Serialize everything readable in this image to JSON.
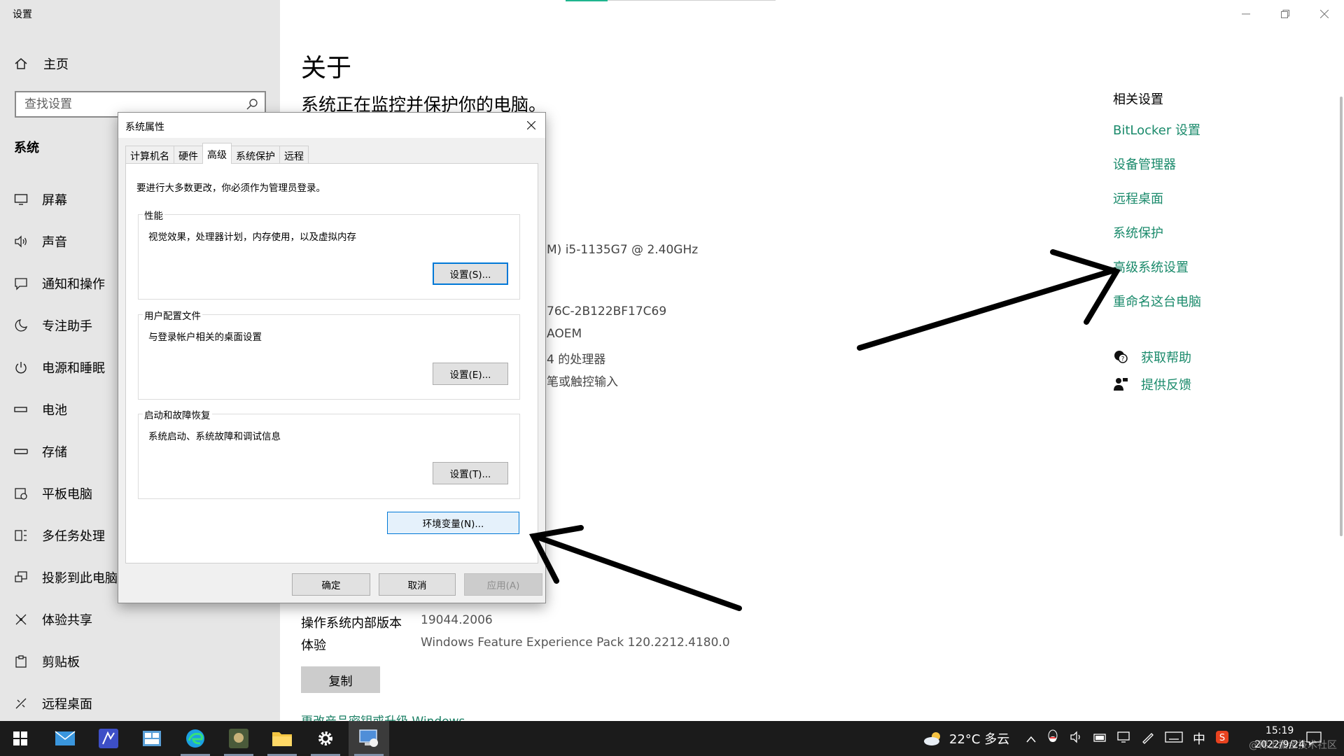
{
  "app": {
    "title": "设置",
    "home_label": "主页",
    "search_placeholder": "查找设置",
    "section_label": "系统"
  },
  "sidebar": {
    "items": [
      {
        "label": "屏幕",
        "icon": "monitor-icon"
      },
      {
        "label": "声音",
        "icon": "speaker-icon"
      },
      {
        "label": "通知和操作",
        "icon": "notification-icon"
      },
      {
        "label": "专注助手",
        "icon": "moon-icon"
      },
      {
        "label": "电源和睡眠",
        "icon": "power-icon"
      },
      {
        "label": "电池",
        "icon": "battery-icon"
      },
      {
        "label": "存储",
        "icon": "storage-icon"
      },
      {
        "label": "平板电脑",
        "icon": "tablet-icon"
      },
      {
        "label": "多任务处理",
        "icon": "multitask-icon"
      },
      {
        "label": "投影到此电脑",
        "icon": "project-icon"
      },
      {
        "label": "体验共享",
        "icon": "share-icon"
      },
      {
        "label": "剪贴板",
        "icon": "clipboard-icon"
      },
      {
        "label": "远程桌面",
        "icon": "remote-icon"
      }
    ]
  },
  "main": {
    "title": "关于",
    "subtitle": "系统正在监控并保护你的电脑。",
    "partial_specs": [
      "M) i5-1135G7 @ 2.40GHz",
      "76C-2B122BF17C69",
      "AOEM",
      "4 的处理器",
      "笔或触控输入"
    ],
    "spec_rows": [
      {
        "label": "操作系统内部版本",
        "value": "19044.2006"
      },
      {
        "label": "体验",
        "value": "Windows Feature Experience Pack 120.2212.4180.0"
      }
    ],
    "copy_label": "复制",
    "upgrade_link": "更改产品密钥或升级 Windows"
  },
  "related": {
    "title": "相关设置",
    "links": [
      "BitLocker 设置",
      "设备管理器",
      "远程桌面",
      "系统保护",
      "高级系统设置",
      "重命名这台电脑"
    ],
    "help": "获取帮助",
    "feedback": "提供反馈"
  },
  "dialog": {
    "title": "系统属性",
    "tabs": [
      "计算机名",
      "硬件",
      "高级",
      "系统保护",
      "远程"
    ],
    "active_tab": "高级",
    "note": "要进行大多数更改，你必须作为管理员登录。",
    "groups": [
      {
        "label": "性能",
        "desc": "视觉效果，处理器计划，内存使用，以及虚拟内存",
        "button": "设置(S)..."
      },
      {
        "label": "用户配置文件",
        "desc": "与登录帐户相关的桌面设置",
        "button": "设置(E)..."
      },
      {
        "label": "启动和故障恢复",
        "desc": "系统启动、系统故障和调试信息",
        "button": "设置(T)..."
      }
    ],
    "env_button": "环境变量(N)...",
    "ok": "确定",
    "cancel": "取消",
    "apply": "应用(A)"
  },
  "taskbar": {
    "weather": "22°C 多云",
    "ime": "中",
    "time": "15:19",
    "date": "2022/9/24",
    "watermark": "@稀土掘金技术社区"
  },
  "colors": {
    "accent_link": "#1a8a6b",
    "focus_blue": "#0078d7",
    "sidebar_bg": "#e6e6e6",
    "taskbar_bg": "#1b1b1b"
  }
}
